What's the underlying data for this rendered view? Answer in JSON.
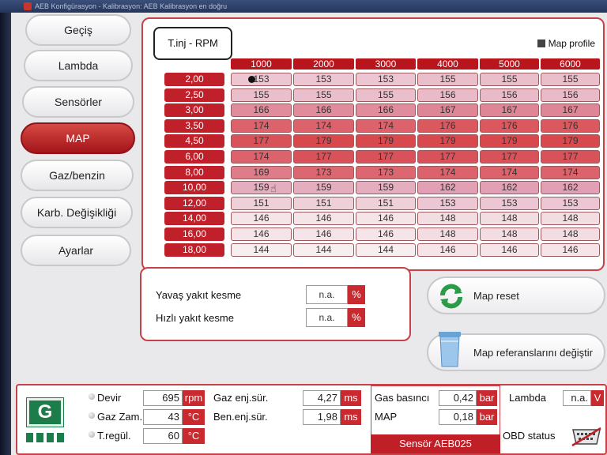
{
  "window": {
    "title": "AEB Konfigürasyon - Kalibrasyon: AEB Kalibrasyon en doğru"
  },
  "nav": {
    "items": [
      {
        "label": "Geçiş",
        "name": "nav-gecis"
      },
      {
        "label": "Lambda",
        "name": "nav-lambda"
      },
      {
        "label": "Sensörler",
        "name": "nav-sensorler"
      },
      {
        "label": "MAP",
        "name": "nav-map",
        "active": true
      },
      {
        "label": "Gaz/benzin",
        "name": "nav-gaz-benzin"
      },
      {
        "label": "Karb. Değişikliği",
        "name": "nav-karb-degisikligi"
      },
      {
        "label": "Ayarlar",
        "name": "nav-ayarlar"
      }
    ]
  },
  "map": {
    "corner_label": "T.inj - RPM",
    "profile_label": "Map profile",
    "profile_checked": true,
    "rpm": [
      "1000",
      "2000",
      "3000",
      "4000",
      "5000",
      "6000"
    ],
    "tinj": [
      "2,00",
      "2,50",
      "3,00",
      "3,50",
      "4,50",
      "6,00",
      "8,00",
      "10,00",
      "12,00",
      "14,00",
      "16,00",
      "18,00"
    ],
    "values": [
      [
        "153",
        "153",
        "153",
        "155",
        "155",
        "155"
      ],
      [
        "155",
        "155",
        "155",
        "156",
        "156",
        "156"
      ],
      [
        "166",
        "166",
        "166",
        "167",
        "167",
        "167"
      ],
      [
        "174",
        "174",
        "174",
        "176",
        "176",
        "176"
      ],
      [
        "177",
        "179",
        "179",
        "179",
        "179",
        "179"
      ],
      [
        "174",
        "177",
        "177",
        "177",
        "177",
        "177"
      ],
      [
        "169",
        "173",
        "173",
        "174",
        "174",
        "174"
      ],
      [
        "159",
        "159",
        "159",
        "162",
        "162",
        "162"
      ],
      [
        "151",
        "151",
        "151",
        "153",
        "153",
        "153"
      ],
      [
        "146",
        "146",
        "146",
        "148",
        "148",
        "148"
      ],
      [
        "146",
        "146",
        "146",
        "148",
        "148",
        "148"
      ],
      [
        "144",
        "144",
        "144",
        "146",
        "146",
        "146"
      ]
    ],
    "heat_colors": {
      "low": "#f7eef0",
      "mid": "#e2a3b7",
      "high": "#d9484d"
    }
  },
  "cut": {
    "slow_label": "Yavaş yakıt kesme",
    "slow_value": "n.a.",
    "fast_label": "Hızlı yakıt kesme",
    "fast_value": "n.a.",
    "unit": "%"
  },
  "actions": {
    "reset_label": "Map reset",
    "change_label": "Map referanslarını değiştir"
  },
  "status": {
    "devir_label": "Devir",
    "devir_value": "695",
    "devir_unit": "rpm",
    "gazzam_label": "Gaz Zam.",
    "gazzam_value": "43",
    "gazzam_unit": "°C",
    "treg_label": "T.regül.",
    "treg_value": "60",
    "treg_unit": "°C",
    "gazenj_label": "Gaz enj.sür.",
    "gazenj_value": "4,27",
    "gazenj_unit": "ms",
    "benenj_label": "Ben.enj.sür.",
    "benenj_value": "1,98",
    "benenj_unit": "ms",
    "gasp_label": "Gas basıncı",
    "gasp_value": "0,42",
    "gasp_unit": "bar",
    "map_label": "MAP",
    "map_value": "0,18",
    "map_unit": "bar",
    "lambda_label": "Lambda",
    "lambda_value": "n.a.",
    "lambda_unit": "V",
    "sensor_label": "Sensör AEB025",
    "obd_label": "OBD status",
    "g_label": "G"
  },
  "colors": {
    "accent": "#c01f27",
    "brand_green": "#1c7c4a"
  }
}
